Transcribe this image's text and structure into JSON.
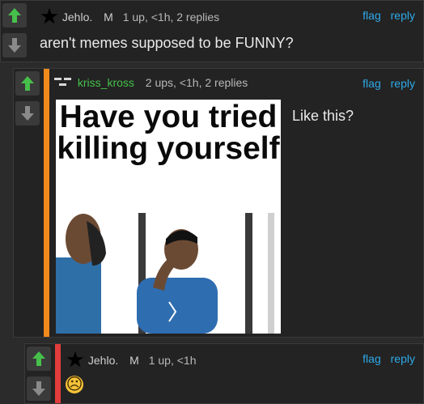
{
  "colors": {
    "upvote": "#46c04a",
    "link": "#2ea9e8",
    "stripe_orange": "#f08a1c",
    "stripe_red": "#e23c3c"
  },
  "comments": [
    {
      "user": "Jehlo.",
      "user_icon": "star-icon",
      "mod": "M",
      "stats": "1 up, <1h, 2 replies",
      "flag": "flag",
      "reply": "reply",
      "text": "aren't memes supposed to be FUNNY?"
    },
    {
      "user": "kriss_kross",
      "user_icon": "bars-icon",
      "stats": "2 ups, <1h, 2 replies",
      "flag": "flag",
      "reply": "reply",
      "text": "Like this?",
      "meme_caption": "Have you tried killing yourself"
    },
    {
      "user": "Jehlo.",
      "user_icon": "star-icon",
      "mod": "M",
      "stats": "1 up, <1h",
      "flag": "flag",
      "reply": "reply",
      "emoji": "☹"
    }
  ]
}
